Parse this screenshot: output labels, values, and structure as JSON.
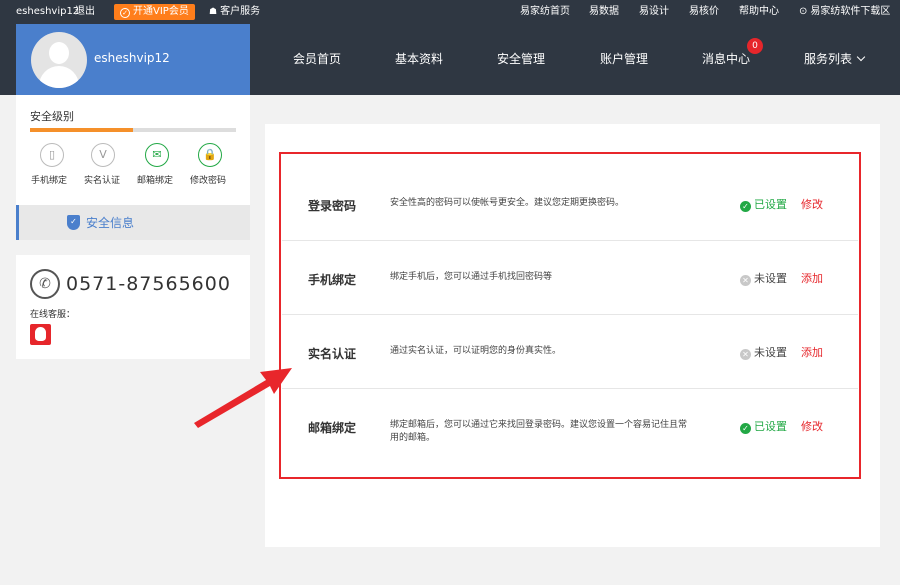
{
  "topbar": {
    "username": "esheshvip12",
    "logout": "退出",
    "vip_button": "开通VIP会员",
    "customer_service": "客户服务",
    "links": [
      "易家纺首页",
      "易数据",
      "易设计",
      "易核价",
      "帮助中心",
      "易家纺软件下载区"
    ]
  },
  "profile": {
    "username": "esheshvip12"
  },
  "nav": {
    "items": [
      "会员首页",
      "基本资料",
      "安全管理",
      "账户管理",
      "消息中心",
      "服务列表"
    ],
    "message_badge": "0"
  },
  "security": {
    "title": "安全级别",
    "level_percent": 50,
    "items": [
      "手机绑定",
      "实名认证",
      "邮箱绑定",
      "修改密码"
    ]
  },
  "sidebar": {
    "security_info": "安全信息"
  },
  "contact": {
    "phone": "0571-87565600",
    "online_label": "在线客服："
  },
  "rows": [
    {
      "name": "登录密码",
      "desc": "安全性高的密码可以使帐号更安全。建议您定期更换密码。",
      "status": "已设置",
      "action": "修改"
    },
    {
      "name": "手机绑定",
      "desc": "绑定手机后，您可以通过手机找回密码等",
      "status": "未设置",
      "action": "添加"
    },
    {
      "name": "实名认证",
      "desc": "通过实名认证，可以证明您的身份真实性。",
      "status": "未设置",
      "action": "添加"
    },
    {
      "name": "邮箱绑定",
      "desc": "绑定邮箱后，您可以通过它来找回登录密码。建议您设置一个容易记住且常用的邮箱。",
      "status": "已设置",
      "action": "修改"
    }
  ],
  "colors": {
    "accent_blue": "#4a7fcc",
    "dark_header": "#2f3742",
    "vip_orange": "#ff7e1b",
    "set_green": "#22a845",
    "action_red": "#e6262b"
  }
}
